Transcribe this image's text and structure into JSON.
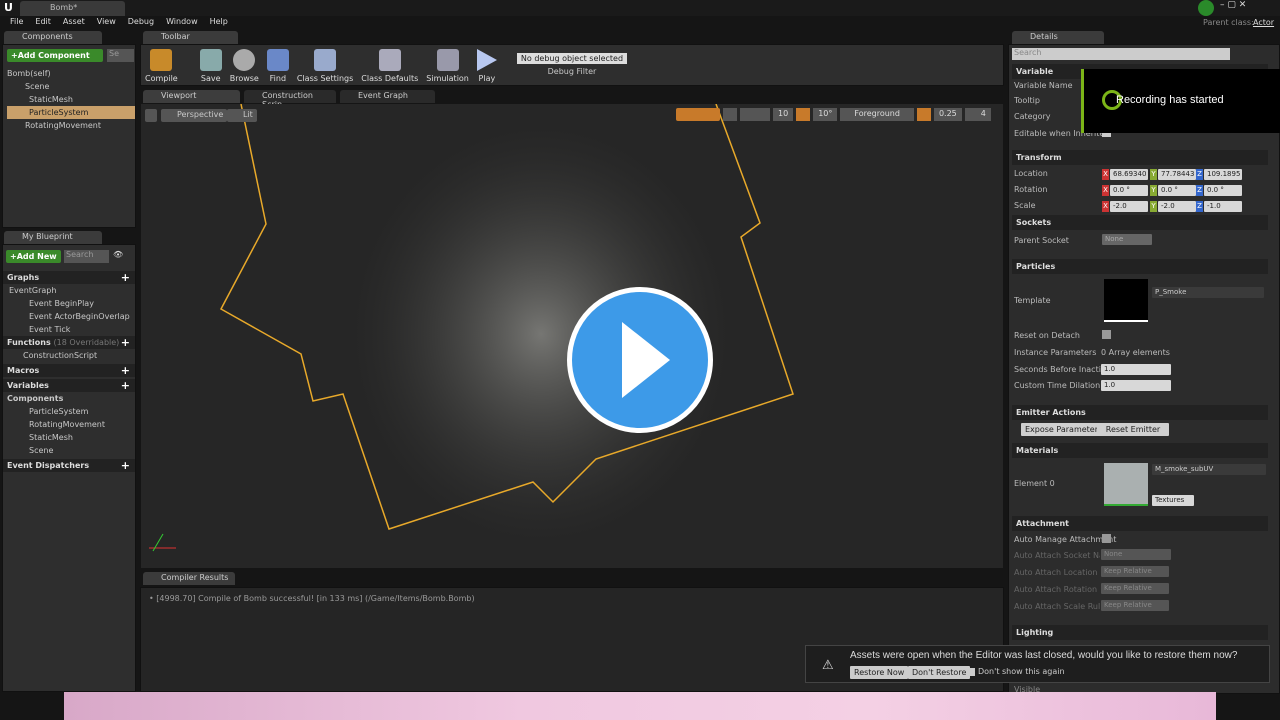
{
  "window": {
    "tab": "Bomb*",
    "parent_class_label": "Parent class:",
    "parent_class": "Actor"
  },
  "menu": [
    "File",
    "Edit",
    "Asset",
    "View",
    "Debug",
    "Window",
    "Help"
  ],
  "components": {
    "tab": "Components",
    "add_label": "+Add Component",
    "search_placeholder": "Se",
    "self": "Bomb(self)",
    "tree": [
      "Scene",
      "StaticMesh",
      "ParticleSystem",
      "RotatingMovement"
    ]
  },
  "toolbar": {
    "tab": "Toolbar",
    "buttons": [
      "Compile",
      "Save",
      "Browse",
      "Find",
      "Class Settings",
      "Class Defaults",
      "Simulation",
      "Play"
    ],
    "debug_object": "No debug object selected",
    "debug_filter": "Debug Filter"
  },
  "editor_tabs": [
    "Viewport",
    "Construction Scrip",
    "Event Graph"
  ],
  "viewport": {
    "perspective": "Perspective",
    "lit": "Lit",
    "grid": "10",
    "rot": "10°",
    "layer": "Foreground",
    "scale": "0.25",
    "speed": "4"
  },
  "my_blueprint": {
    "tab": "My Blueprint",
    "add_new": "+Add New",
    "search_placeholder": "Search",
    "graphs": "Graphs",
    "event_graph": "EventGraph",
    "events": [
      "Event BeginPlay",
      "Event ActorBeginOverlap",
      "Event Tick"
    ],
    "functions": "Functions",
    "functions_note": "(18 Overridable)",
    "construction": "ConstructionScript",
    "macros": "Macros",
    "variables": "Variables",
    "components": "Components",
    "component_vars": [
      "ParticleSystem",
      "RotatingMovement",
      "StaticMesh",
      "Scene"
    ],
    "dispatchers": "Event Dispatchers"
  },
  "compiler": {
    "tab": "Compiler Results",
    "message": "[4998.70] Compile of Bomb successful! [in 133 ms] (/Game/Items/Bomb.Bomb)"
  },
  "details": {
    "tab": "Details",
    "search_placeholder": "Search",
    "variable": {
      "title": "Variable",
      "rows": [
        "Variable Name",
        "Tooltip",
        "Category",
        "Editable when Inherited"
      ]
    },
    "transform": {
      "title": "Transform",
      "location_label": "Location",
      "rotation_label": "Rotation",
      "scale_label": "Scale",
      "location": [
        "68.69340",
        "77.78443",
        "109.1895"
      ],
      "rotation": [
        "0.0 °",
        "0.0 °",
        "0.0 °"
      ],
      "scale": [
        "-2.0",
        "-2.0",
        "-1.0"
      ]
    },
    "sockets": {
      "title": "Sockets",
      "parent_socket": "Parent Socket",
      "value": "None"
    },
    "particles": {
      "title": "Particles",
      "template": "Template",
      "template_value": "P_Smoke",
      "reset": "Reset on Detach",
      "instance": "Instance Parameters",
      "instance_value": "0 Array elements",
      "seconds": "Seconds Before Inactive",
      "seconds_value": "1.0",
      "dilation": "Custom Time Dilation",
      "dilation_value": "1.0"
    },
    "emitter": {
      "title": "Emitter Actions",
      "expose": "Expose Parameter",
      "reset": "Reset Emitter"
    },
    "materials": {
      "title": "Materials",
      "element": "Element 0",
      "value": "M_smoke_subUV",
      "textures": "Textures"
    },
    "attachment": {
      "title": "Attachment",
      "rows": [
        "Auto Manage Attachment",
        "Auto Attach Socket Name",
        "Auto Attach Location Rule",
        "Auto Attach Rotation Rule",
        "Auto Attach Scale Rule"
      ],
      "socket_value": "None",
      "rule": "Keep Relative"
    },
    "lighting": {
      "title": "Lighting",
      "visible": "Visible"
    }
  },
  "recording": {
    "text": "Recording has started",
    "accent": "#7cb518"
  },
  "notification": {
    "text": "Assets were open when the Editor was last closed, would you like to restore them now?",
    "restore": "Restore Now",
    "dont_restore": "Don't Restore",
    "dont_show": "Don't show this again"
  },
  "colors": {
    "selection": "#c9a06a",
    "play_overlay": "#3d9ae8",
    "bounds": "#e8a92a"
  }
}
